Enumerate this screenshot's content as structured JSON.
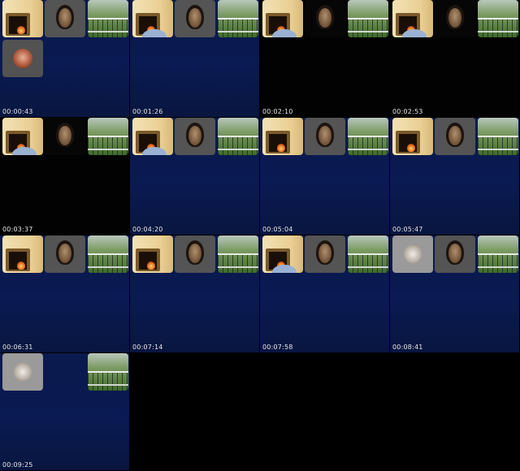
{
  "contact_sheet": {
    "frames": [
      {
        "timestamp": "00:00:43",
        "bg": "navy",
        "tiles": [
          "room",
          "face",
          "balcony",
          "avatar-red"
        ]
      },
      {
        "timestamp": "00:01:26",
        "bg": "navy",
        "tiles": [
          "room-head",
          "face",
          "balcony"
        ]
      },
      {
        "timestamp": "00:02:10",
        "bg": "black",
        "tiles": [
          "room-head",
          "face-dark",
          "balcony"
        ]
      },
      {
        "timestamp": "00:02:53",
        "bg": "black",
        "tiles": [
          "room-head",
          "face-dark",
          "balcony"
        ]
      },
      {
        "timestamp": "00:03:37",
        "bg": "black",
        "tiles": [
          "room-head",
          "face-dark",
          "balcony"
        ]
      },
      {
        "timestamp": "00:04:20",
        "bg": "navy",
        "tiles": [
          "room-head",
          "face",
          "balcony"
        ]
      },
      {
        "timestamp": "00:05:04",
        "bg": "navy",
        "tiles": [
          "room",
          "face",
          "balcony"
        ]
      },
      {
        "timestamp": "00:05:47",
        "bg": "navy",
        "tiles": [
          "room",
          "face",
          "balcony"
        ]
      },
      {
        "timestamp": "00:06:31",
        "bg": "navy",
        "tiles": [
          "room",
          "face",
          "balcony"
        ]
      },
      {
        "timestamp": "00:07:14",
        "bg": "navy",
        "tiles": [
          "room",
          "face",
          "balcony"
        ]
      },
      {
        "timestamp": "00:07:58",
        "bg": "navy",
        "tiles": [
          "room-head",
          "face",
          "balcony"
        ]
      },
      {
        "timestamp": "00:08:41",
        "bg": "navy",
        "tiles": [
          "avatar-gray",
          "face",
          "balcony"
        ]
      },
      {
        "timestamp": "00:09:25",
        "bg": "navy",
        "tiles": [
          "avatar-gray",
          "empty",
          "balcony"
        ]
      }
    ]
  },
  "colors": {
    "navy": "#0a1a52",
    "black": "#020202",
    "timestamp_text": "#e6e6e6",
    "tile_gray": "#545454"
  }
}
